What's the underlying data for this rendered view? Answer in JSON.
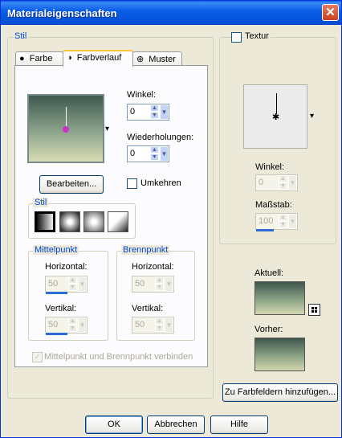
{
  "window": {
    "title": "Materialeigenschaften",
    "close_glyph": "✕"
  },
  "stil_group": {
    "legend": "Stil",
    "tabs": [
      {
        "label": "Farbe",
        "icon": "filled-circle-icon",
        "glyph": "●"
      },
      {
        "label": "Farbverlauf",
        "icon": "half-circle-icon",
        "glyph": "◑",
        "active": true
      },
      {
        "label": "Muster",
        "icon": "globe-pattern-icon",
        "glyph": "⊕"
      }
    ]
  },
  "gradient_panel": {
    "winkel_label": "Winkel:",
    "winkel_value": "0",
    "wiederholungen_label": "Wiederholungen:",
    "wiederholungen_value": "0",
    "bearbeiten_label": "Bearbeiten...",
    "umkehren_label": "Umkehren",
    "stil_legend": "Stil",
    "dropdown_glyph": "▾",
    "gradient_colors": {
      "top": "#3F5A50",
      "mid": "#8DA58C",
      "bottom": "#D8DCB4"
    },
    "marker_color": "#C832C8",
    "mittelpunkt": {
      "legend": "Mittelpunkt",
      "horizontal_label": "Horizontal:",
      "horizontal_value": "50",
      "vertikal_label": "Vertikal:",
      "vertikal_value": "50"
    },
    "brennpunkt": {
      "legend": "Brennpunkt",
      "horizontal_label": "Horizontal:",
      "horizontal_value": "50",
      "vertikal_label": "Vertikal:",
      "vertikal_value": "50"
    },
    "link_label": "Mittelpunkt und Brennpunkt verbinden",
    "link_check_glyph": "✓"
  },
  "textur": {
    "label": "Textur",
    "winkel_label": "Winkel:",
    "winkel_value": "0",
    "massstab_label": "Maßstab:",
    "massstab_value": "100",
    "dropdown_glyph": "▾",
    "center_glyph": "✱"
  },
  "preview": {
    "aktuell_label": "Aktuell:",
    "vorher_label": "Vorher:",
    "palette_button_icon": "palette-grid-icon",
    "add_swatch_label": "Zu Farbfeldern hinzufügen..."
  },
  "footer": {
    "ok_label": "OK",
    "abbrechen_label": "Abbrechen",
    "hilfe_label": "Hilfe"
  },
  "spinner_glyphs": {
    "up": "▲",
    "down": "▼"
  }
}
